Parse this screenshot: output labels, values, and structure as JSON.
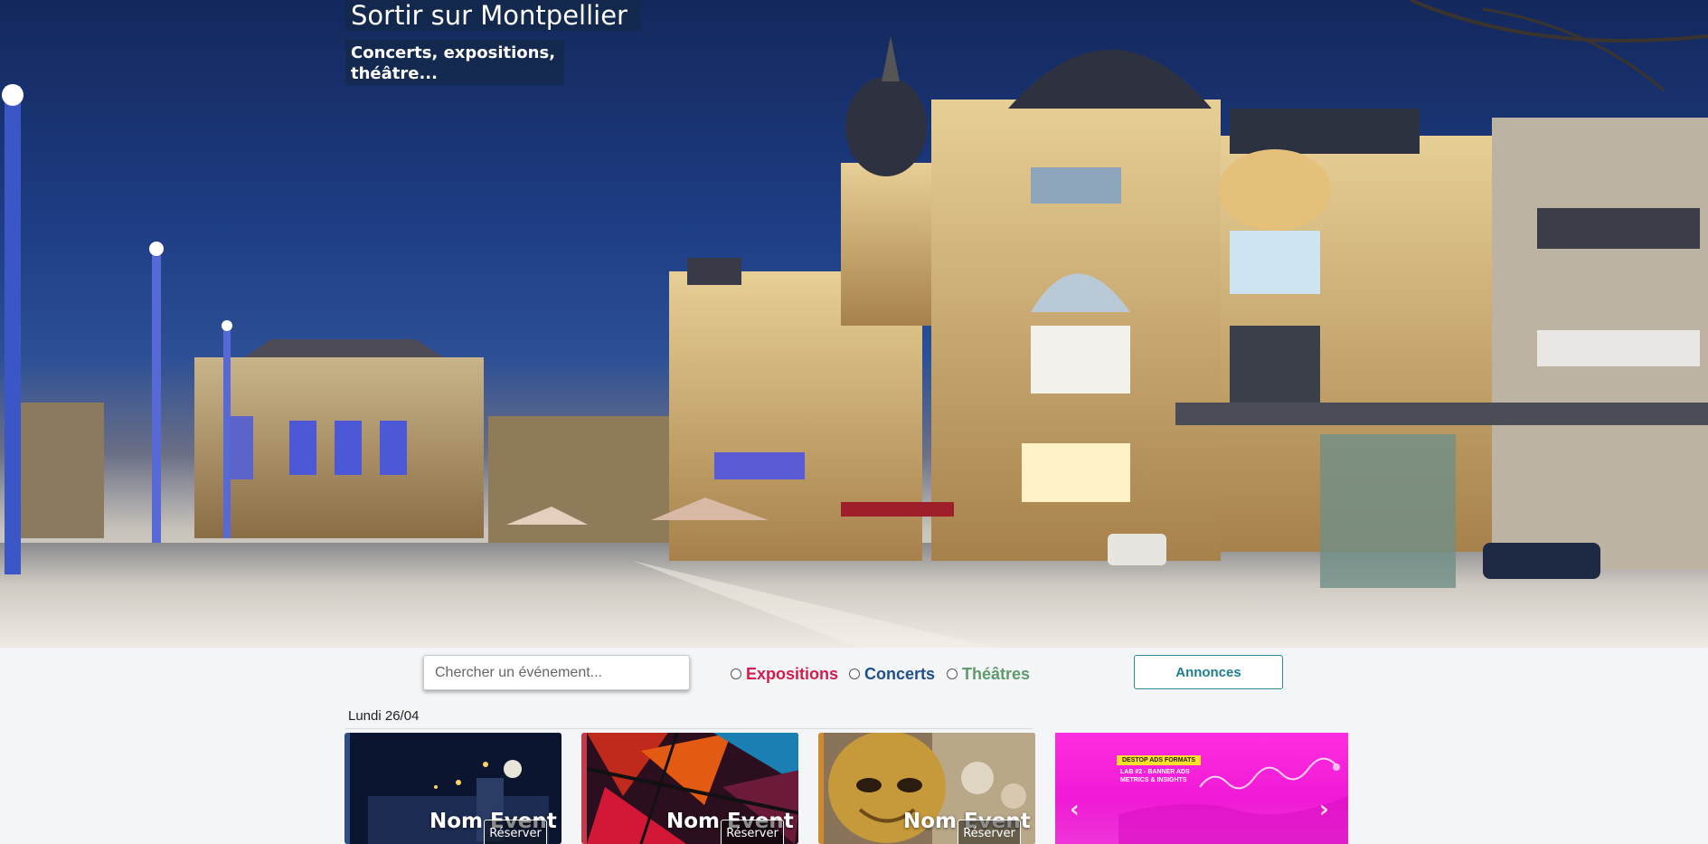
{
  "hero": {
    "title": "Sortir sur Montpellier",
    "subtitle": "Concerts, expositions, théâtre..."
  },
  "filters": {
    "search_placeholder": "Chercher un événement...",
    "categories": [
      {
        "label": "Expositions",
        "color": "#d11d4d"
      },
      {
        "label": "Concerts",
        "color": "#1e4f8f"
      },
      {
        "label": "Théâtres",
        "color": "#5f9a6c"
      }
    ],
    "ads_button": "Annonces"
  },
  "events": {
    "date": "Lundi 26/04",
    "cards": [
      {
        "name": "Nom Event",
        "button": "Réserver"
      },
      {
        "name": "Nom Event",
        "button": "Réserver"
      },
      {
        "name": "Nom Event",
        "button": "Réserver"
      }
    ]
  },
  "ad_banner": {
    "badge": "DESTOP ADS FORMATS",
    "line1": "LAB #2 - BANNER ADS",
    "line2": "METRICS & INSIGHTS",
    "prev_icon": "chevron-left-icon",
    "next_icon": "chevron-right-icon"
  }
}
